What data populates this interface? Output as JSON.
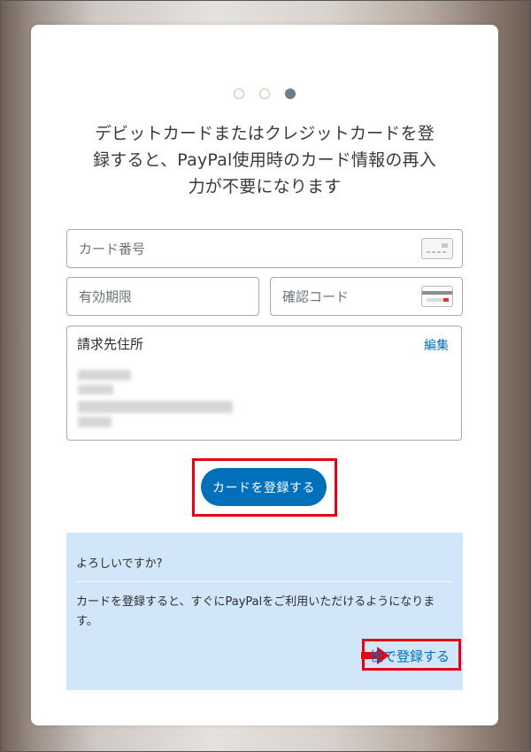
{
  "progress": {
    "total_steps": 3,
    "current_step": 3
  },
  "intro_text": "デビットカードまたはクレジットカードを登録すると、PayPal使用時のカード情報の再入力が不要になります",
  "card_number": {
    "placeholder": "カード番号",
    "value": ""
  },
  "expiry": {
    "placeholder": "有効期限",
    "value": ""
  },
  "cvv": {
    "placeholder": "確認コード",
    "value": ""
  },
  "billing": {
    "title": "請求先住所",
    "edit_label": "編集"
  },
  "register_button": {
    "label": "カードを登録する"
  },
  "info": {
    "question": "よろしいですか?",
    "body": "カードを登録すると、すぐにPayPalをご利用いただけるようになります。",
    "later_link": "後で登録する"
  },
  "colors": {
    "brand_blue": "#0070ba",
    "highlight_red": "#e60012",
    "info_bg": "#d1e6f8"
  }
}
